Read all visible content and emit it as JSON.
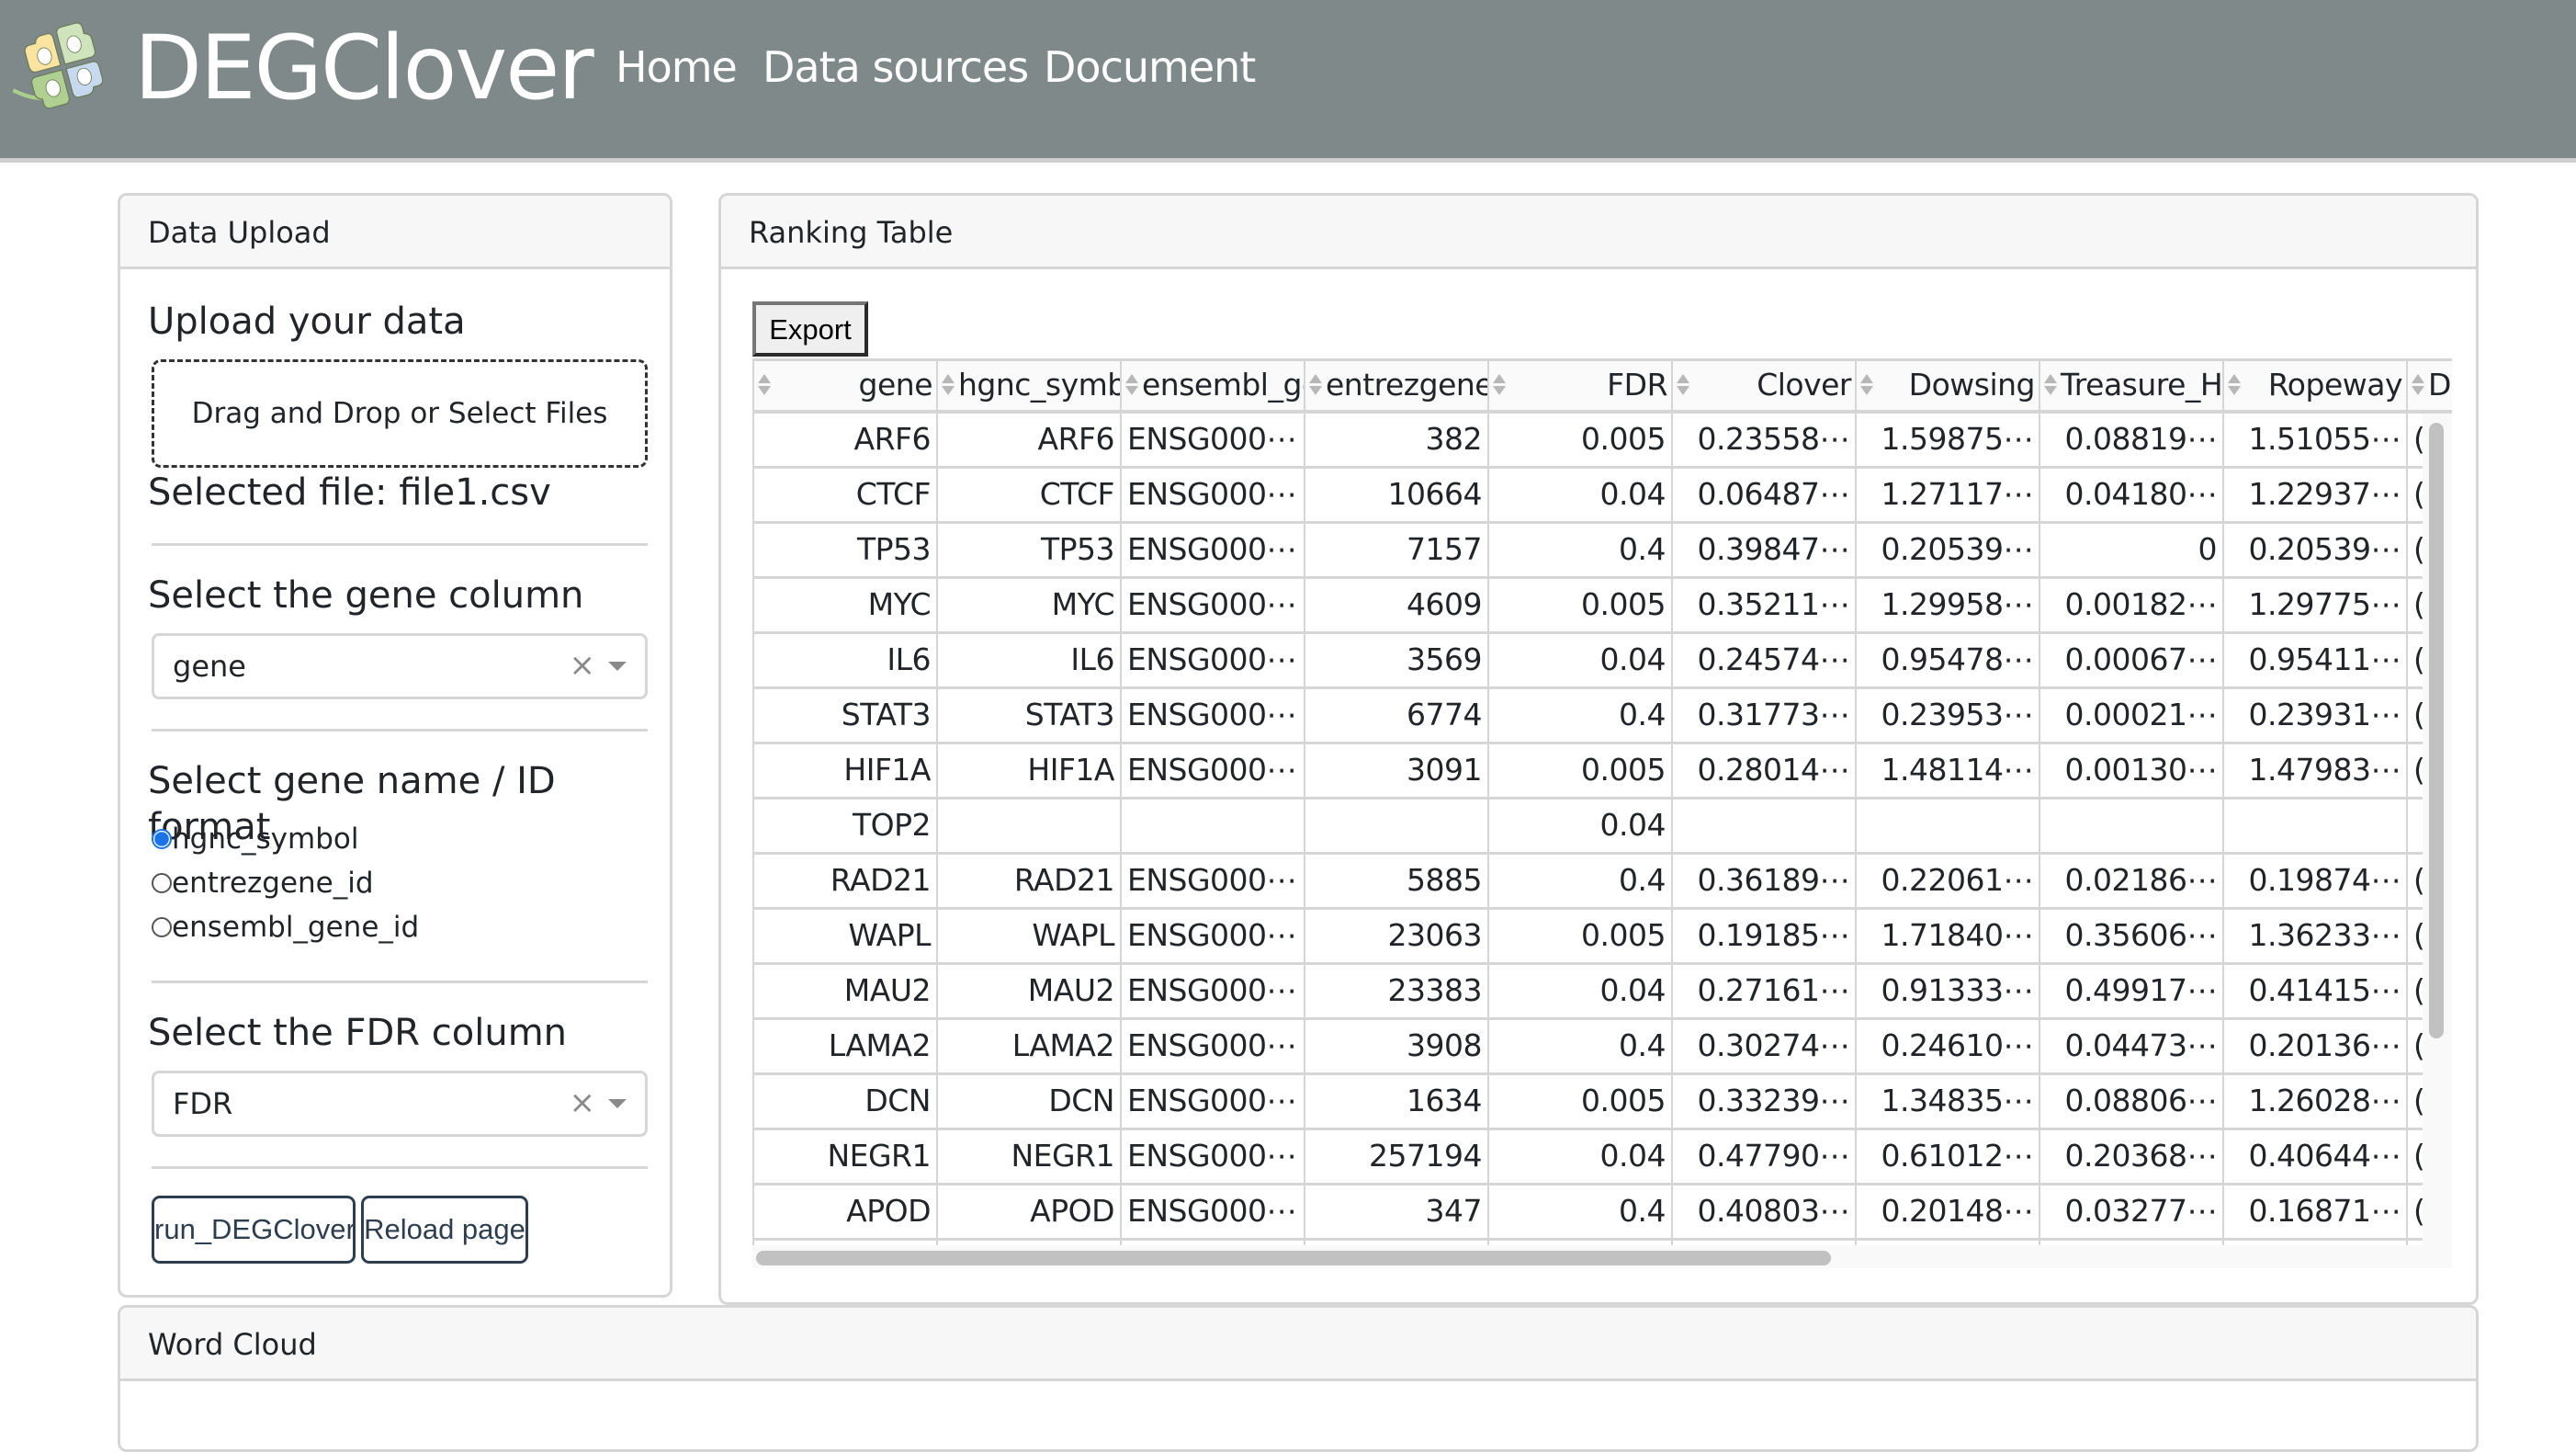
{
  "navbar": {
    "brand": "DEGClover",
    "links": [
      "Home",
      "Data sources",
      "Document"
    ],
    "background_color": "#7f898a"
  },
  "upload_panel": {
    "header": "Data Upload",
    "upload_title": "Upload your data",
    "dropzone_label": "Drag and Drop or Select Files",
    "selected_file": "Selected file: file1.csv",
    "gene_column": {
      "label": "Select the gene column",
      "value": "gene",
      "clear_icon": "×"
    },
    "id_format": {
      "label": "Select gene name / ID format",
      "options": [
        {
          "label": "hgnc_symbol",
          "checked": true
        },
        {
          "label": "entrezgene_id",
          "checked": false
        },
        {
          "label": "ensembl_gene_id",
          "checked": false
        }
      ]
    },
    "fdr_column": {
      "label": "Select the FDR column",
      "value": "FDR",
      "clear_icon": "×"
    },
    "buttons": {
      "run": "run_DEGClover",
      "reload": "Reload page"
    }
  },
  "ranking_panel": {
    "header": "Ranking Table",
    "export_label": "Export",
    "columns": [
      "gene",
      "hgnc_symb",
      "ensembl_ge",
      "entrezgene",
      "FDR",
      "Clover",
      "Dowsing",
      "Treasure_H",
      "Ropeway",
      "D"
    ],
    "rows": [
      [
        "ARF6",
        "ARF6",
        "ENSG000⋯",
        "382",
        "0.005",
        "0.23558⋯",
        "1.59875⋯",
        "0.08819⋯",
        "1.51055⋯",
        "("
      ],
      [
        "CTCF",
        "CTCF",
        "ENSG000⋯",
        "10664",
        "0.04",
        "0.06487⋯",
        "1.27117⋯",
        "0.04180⋯",
        "1.22937⋯",
        "("
      ],
      [
        "TP53",
        "TP53",
        "ENSG000⋯",
        "7157",
        "0.4",
        "0.39847⋯",
        "0.20539⋯",
        "0",
        "0.20539⋯",
        "("
      ],
      [
        "MYC",
        "MYC",
        "ENSG000⋯",
        "4609",
        "0.005",
        "0.35211⋯",
        "1.29958⋯",
        "0.00182⋯",
        "1.29775⋯",
        "("
      ],
      [
        "IL6",
        "IL6",
        "ENSG000⋯",
        "3569",
        "0.04",
        "0.24574⋯",
        "0.95478⋯",
        "0.00067⋯",
        "0.95411⋯",
        "("
      ],
      [
        "STAT3",
        "STAT3",
        "ENSG000⋯",
        "6774",
        "0.4",
        "0.31773⋯",
        "0.23953⋯",
        "0.00021⋯",
        "0.23931⋯",
        "("
      ],
      [
        "HIF1A",
        "HIF1A",
        "ENSG000⋯",
        "3091",
        "0.005",
        "0.28014⋯",
        "1.48114⋯",
        "0.00130⋯",
        "1.47983⋯",
        "("
      ],
      [
        "TOP2",
        "",
        "",
        "",
        "0.04",
        "",
        "",
        "",
        "",
        ""
      ],
      [
        "RAD21",
        "RAD21",
        "ENSG000⋯",
        "5885",
        "0.4",
        "0.36189⋯",
        "0.22061⋯",
        "0.02186⋯",
        "0.19874⋯",
        "("
      ],
      [
        "WAPL",
        "WAPL",
        "ENSG000⋯",
        "23063",
        "0.005",
        "0.19185⋯",
        "1.71840⋯",
        "0.35606⋯",
        "1.36233⋯",
        "("
      ],
      [
        "MAU2",
        "MAU2",
        "ENSG000⋯",
        "23383",
        "0.04",
        "0.27161⋯",
        "0.91333⋯",
        "0.49917⋯",
        "0.41415⋯",
        "("
      ],
      [
        "LAMA2",
        "LAMA2",
        "ENSG000⋯",
        "3908",
        "0.4",
        "0.30274⋯",
        "0.24610⋯",
        "0.04473⋯",
        "0.20136⋯",
        "("
      ],
      [
        "DCN",
        "DCN",
        "ENSG000⋯",
        "1634",
        "0.005",
        "0.33239⋯",
        "1.34835⋯",
        "0.08806⋯",
        "1.26028⋯",
        "("
      ],
      [
        "NEGR1",
        "NEGR1",
        "ENSG000⋯",
        "257194",
        "0.04",
        "0.47790⋯",
        "0.61012⋯",
        "0.20368⋯",
        "0.40644⋯",
        "("
      ],
      [
        "APOD",
        "APOD",
        "ENSG000⋯",
        "347",
        "0.4",
        "0.40803⋯",
        "0.20148⋯",
        "0.03277⋯",
        "0.16871⋯",
        "("
      ]
    ]
  },
  "wordcloud_panel": {
    "header": "Word Cloud"
  }
}
